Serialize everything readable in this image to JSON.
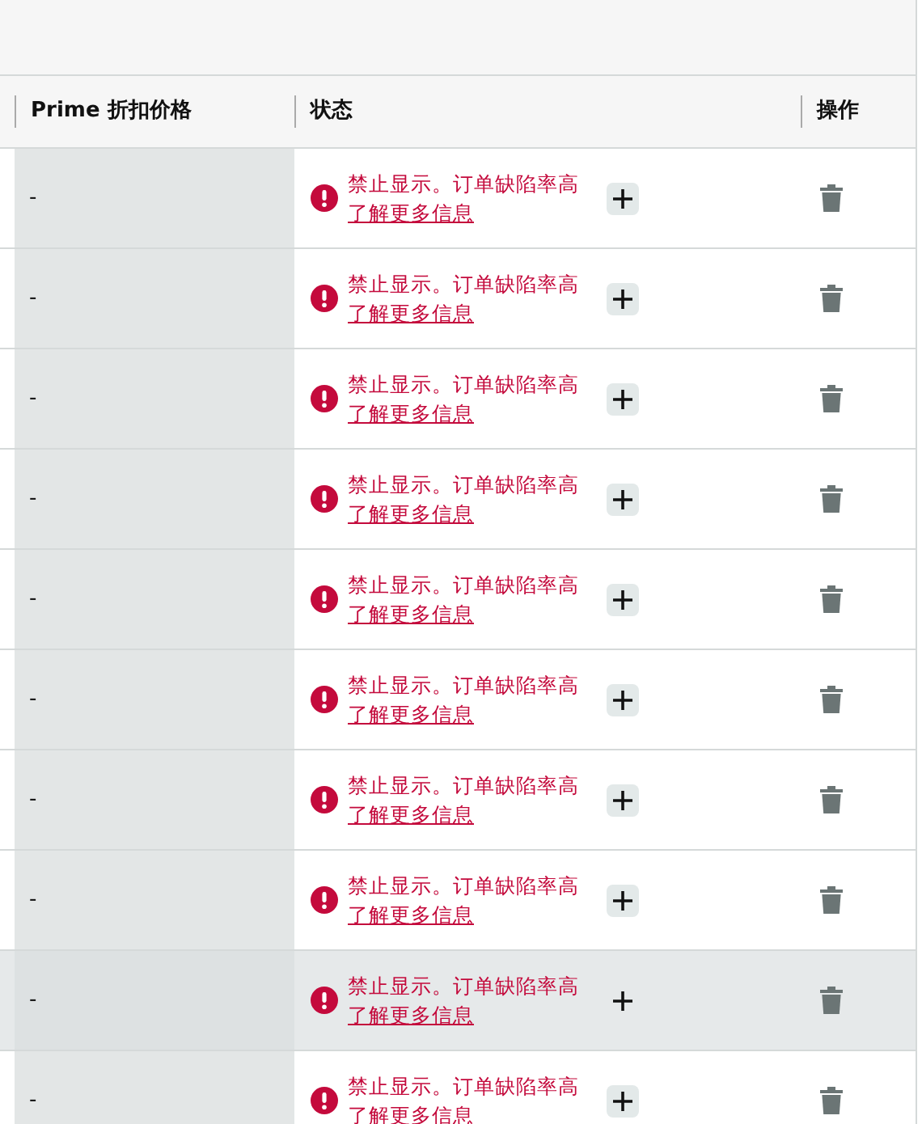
{
  "table": {
    "columns": [
      {
        "label": "Prime 折扣价格"
      },
      {
        "label": "状态"
      },
      {
        "label": "操作"
      }
    ],
    "rows": [
      {
        "price": "-",
        "status": "禁止显示。订单缺陷率高",
        "link": "了解更多信息",
        "hovered": false
      },
      {
        "price": "-",
        "status": "禁止显示。订单缺陷率高",
        "link": "了解更多信息",
        "hovered": false
      },
      {
        "price": "-",
        "status": "禁止显示。订单缺陷率高",
        "link": "了解更多信息",
        "hovered": false
      },
      {
        "price": "-",
        "status": "禁止显示。订单缺陷率高",
        "link": "了解更多信息",
        "hovered": false
      },
      {
        "price": "-",
        "status": "禁止显示。订单缺陷率高",
        "link": "了解更多信息",
        "hovered": false
      },
      {
        "price": "-",
        "status": "禁止显示。订单缺陷率高",
        "link": "了解更多信息",
        "hovered": false
      },
      {
        "price": "-",
        "status": "禁止显示。订单缺陷率高",
        "link": "了解更多信息",
        "hovered": false
      },
      {
        "price": "-",
        "status": "禁止显示。订单缺陷率高",
        "link": "了解更多信息",
        "hovered": false
      },
      {
        "price": "-",
        "status": "禁止显示。订单缺陷率高",
        "link": "了解更多信息",
        "hovered": true
      },
      {
        "price": "-",
        "status": "禁止显示。订单缺陷率高",
        "link": "了解更多信息",
        "hovered": false
      }
    ]
  }
}
